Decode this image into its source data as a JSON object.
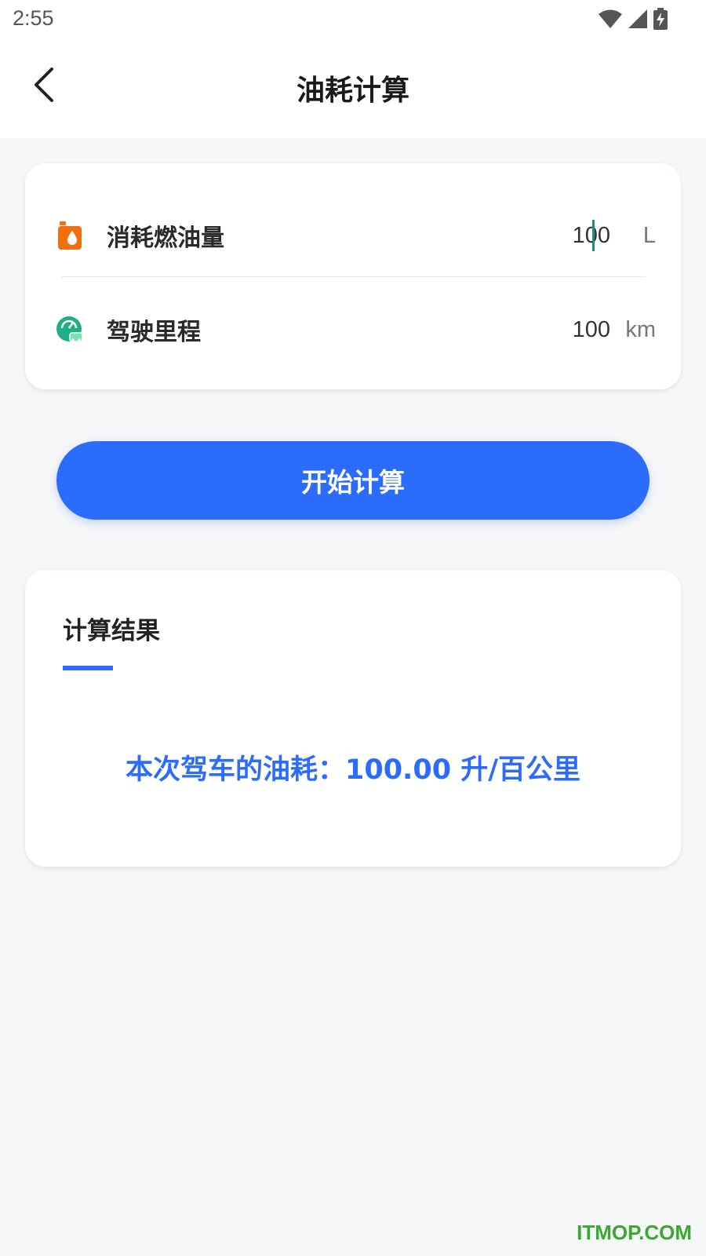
{
  "status_bar": {
    "time": "2:55"
  },
  "app_bar": {
    "title": "油耗计算"
  },
  "inputs": {
    "fuel": {
      "label": "消耗燃油量",
      "value": "100",
      "unit": "L",
      "icon": "fuel-can-icon",
      "icon_color": "#f07010"
    },
    "distance": {
      "label": "驾驶里程",
      "value": "100",
      "unit": "km",
      "icon": "speedometer-car-icon",
      "icon_color": "#1fae86"
    }
  },
  "actions": {
    "calculate_label": "开始计算",
    "button_color": "#2c6cfc"
  },
  "result": {
    "title": "计算结果",
    "text": "本次驾车的油耗：100.00 升/百公里",
    "accent_color": "#2c6cfc"
  },
  "watermark": "ITMOP.COM"
}
